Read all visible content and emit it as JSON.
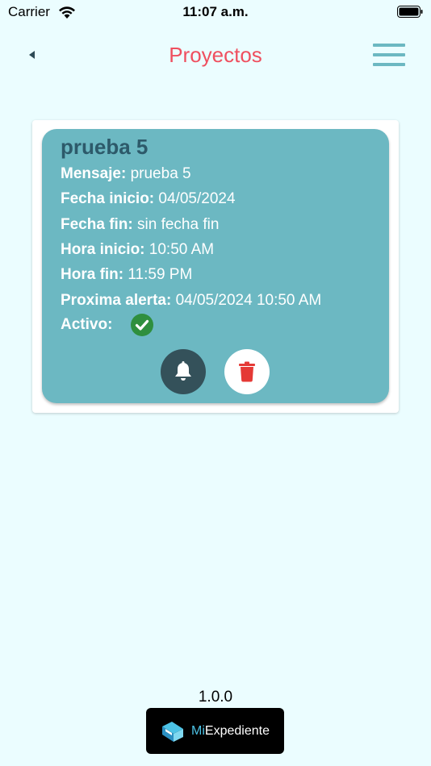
{
  "status": {
    "carrier": "Carrier",
    "time": "11:07 a.m."
  },
  "nav": {
    "title": "Proyectos"
  },
  "project": {
    "name": "prueba 5",
    "mensaje_label": "Mensaje:",
    "mensaje": "prueba 5",
    "fecha_inicio_label": "Fecha inicio:",
    "fecha_inicio": "04/05/2024",
    "fecha_fin_label": "Fecha fin:",
    "fecha_fin": "sin fecha fin",
    "hora_inicio_label": "Hora inicio:",
    "hora_inicio": "10:50 AM",
    "hora_fin_label": "Hora fin:",
    "hora_fin": "11:59 PM",
    "proxima_label": "Proxima alerta:",
    "proxima": "04/05/2024 10:50 AM",
    "activo_label": "Activo:"
  },
  "footer": {
    "version": "1.0.0",
    "brand_prefix": "Mi",
    "brand_suffix": "Expediente"
  },
  "colors": {
    "background": "#ebfdff",
    "title": "#ef4f5f",
    "card": "#6cb8c2",
    "trash": "#e53935",
    "active": "#2f8f3e"
  },
  "icons": [
    "wifi-icon",
    "battery-icon",
    "back-icon",
    "menu-icon",
    "check-icon",
    "bell-icon",
    "trash-icon",
    "brand-logo-icon"
  ]
}
